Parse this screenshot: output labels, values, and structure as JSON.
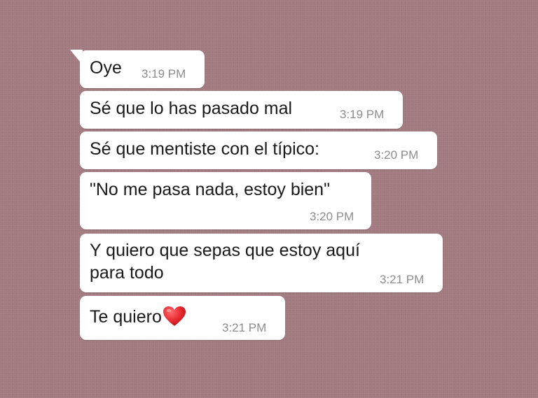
{
  "colors": {
    "background": "#a27b81",
    "bubble": "#ffffff",
    "timestamp": "#8c8c8c",
    "heart": "#e3242b"
  },
  "messages": [
    {
      "text": "Oye",
      "time": "3:19 PM"
    },
    {
      "text": "Sé que lo has pasado mal",
      "time": "3:19 PM"
    },
    {
      "text": "Sé que mentiste con el típico:",
      "time": "3:20 PM"
    },
    {
      "text": "\"No me pasa nada, estoy bien\"",
      "time": "3:20 PM"
    },
    {
      "text_line1": "Y quiero que sepas que estoy aquí",
      "text_line2": "para todo",
      "time": "3:21 PM"
    },
    {
      "text": "Te quiero",
      "emoji": "red-heart-icon",
      "time": "3:21 PM"
    }
  ]
}
